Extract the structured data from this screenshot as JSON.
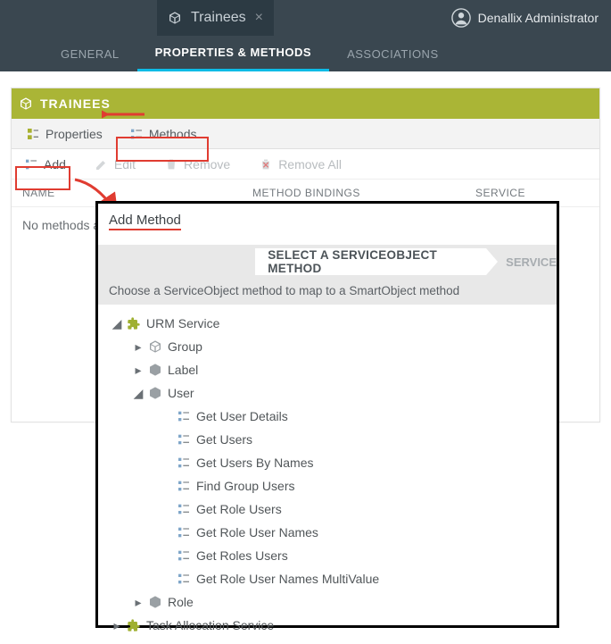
{
  "topbar": {
    "tab_label": "Trainees",
    "user_name": "Denallix Administrator"
  },
  "subtabs": {
    "general": "GENERAL",
    "properties_methods": "PROPERTIES & METHODS",
    "associations": "ASSOCIATIONS"
  },
  "panel": {
    "title": "TRAINEES",
    "tab_properties": "Properties",
    "tab_methods": "Methods",
    "btn_add": "Add",
    "btn_edit": "Edit",
    "btn_remove": "Remove",
    "btn_remove_all": "Remove All",
    "col_name": "NAME",
    "col_bindings": "METHOD BINDINGS",
    "col_service": "SERVICE",
    "empty_text": "No methods a"
  },
  "popup": {
    "title": "Add Method",
    "step_active": "SELECT A SERVICEOBJECT METHOD",
    "step_next": "SERVICE",
    "instruction": "Choose a ServiceObject method to map to a SmartObject method",
    "tree": {
      "urm": "URM Service",
      "group": "Group",
      "label": "Label",
      "user": "User",
      "methods": [
        "Get User Details",
        "Get Users",
        "Get Users By Names",
        "Find Group Users",
        "Get Role Users",
        "Get Role User Names",
        "Get Roles Users",
        "Get Role User Names MultiValue"
      ],
      "role": "Role",
      "task_alloc": "Task Allocation Service"
    }
  }
}
